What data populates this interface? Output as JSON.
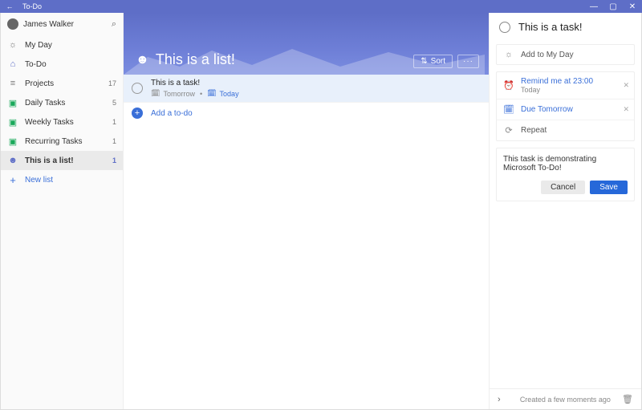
{
  "titlebar": {
    "title": "To-Do"
  },
  "user": {
    "name": "James Walker"
  },
  "nav": {
    "my_day": "My Day",
    "todo": "To-Do",
    "projects": {
      "label": "Projects",
      "count": "17"
    },
    "daily": {
      "label": "Daily Tasks",
      "count": "5"
    },
    "weekly": {
      "label": "Weekly Tasks",
      "count": "1"
    },
    "recurring": {
      "label": "Recurring Tasks",
      "count": "1"
    },
    "this_list": {
      "label": "This is a list!",
      "count": "1"
    },
    "new_list": "New list"
  },
  "hero": {
    "title": "This is a list!",
    "sort": "Sort",
    "more": "···"
  },
  "task": {
    "title": "This is a task!",
    "meta_due": "Tomorrow",
    "meta_added": "Today"
  },
  "add": {
    "label": "Add a to-do"
  },
  "details": {
    "title": "This is a task!",
    "add_my_day": "Add to My Day",
    "remind": {
      "label": "Remind me at 23:00",
      "sub": "Today"
    },
    "due": "Due Tomorrow",
    "repeat": "Repeat",
    "note": "This task is demonstrating Microsoft To-Do!",
    "cancel": "Cancel",
    "save": "Save",
    "footer": "Created a few moments ago"
  }
}
